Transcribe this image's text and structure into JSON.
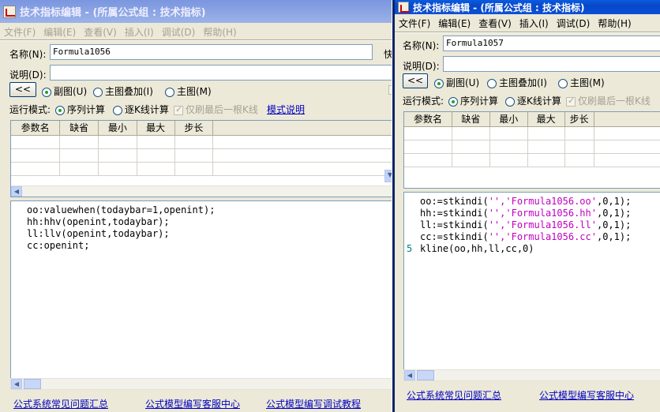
{
  "win1": {
    "title": "技术指标编辑 - (所属公式组 : 技术指标)",
    "menu": [
      "文件(F)",
      "编辑(E)",
      "查看(V)",
      "插入(I)",
      "调试(D)",
      "帮助(H)"
    ],
    "name_label": "名称(N):",
    "name_value": "Formula1056",
    "quick_label": "快",
    "desc_label": "说明(D):",
    "collapse_btn": "<<",
    "radio_sub": "副图(U)",
    "radio_overlay": "主图叠加(I)",
    "radio_main": "主图(M)",
    "mode_label": "运行模式:",
    "mode_seq": "序列计算",
    "mode_k": "逐K线计算",
    "mode_last": "仅刷最后一根K线",
    "mode_link": "模式说明",
    "cols": [
      "参数名",
      "缺省",
      "最小",
      "最大",
      "步长"
    ],
    "code": [
      "oo:valuewhen(todaybar=1,openint);",
      "hh:hhv(openint,todaybar);",
      "ll:llv(openint,todaybar);",
      "cc:openint;"
    ],
    "links": [
      "公式系统常见问题汇总",
      "公式模型编写客服中心",
      "公式模型编写调试教程"
    ]
  },
  "win2": {
    "title": "技术指标编辑 - (所属公式组 : 技术指标)",
    "menu": [
      "文件(F)",
      "编辑(E)",
      "查看(V)",
      "插入(I)",
      "调试(D)",
      "帮助(H)"
    ],
    "name_label": "名称(N):",
    "name_value": "Formula1057",
    "desc_label": "说明(D):",
    "collapse_btn": "<<",
    "radio_sub": "副图(U)",
    "radio_overlay": "主图叠加(I)",
    "radio_main": "主图(M)",
    "mode_label": "运行模式:",
    "mode_seq": "序列计算",
    "mode_k": "逐K线计算",
    "mode_last": "仅刷最后一根K线",
    "cols": [
      "参数名",
      "缺省",
      "最小",
      "最大",
      "步长"
    ],
    "code_lines": [
      {
        "a": "oo:=stkindi(",
        "s": "'','Formula1056.oo'",
        "b": ",0,1);"
      },
      {
        "a": "hh:=stkindi(",
        "s": "'','Formula1056.hh'",
        "b": ",0,1);"
      },
      {
        "a": "ll:=stkindi(",
        "s": "'','Formula1056.ll'",
        "b": ",0,1);"
      },
      {
        "a": "cc:=stkindi(",
        "s": "'','Formula1056.cc'",
        "b": ",0,1);"
      }
    ],
    "line5_num": "5",
    "line5": "kline(oo,hh,ll,cc,0)",
    "links": [
      "公式系统常见问题汇总",
      "公式模型编写客服中心"
    ]
  }
}
